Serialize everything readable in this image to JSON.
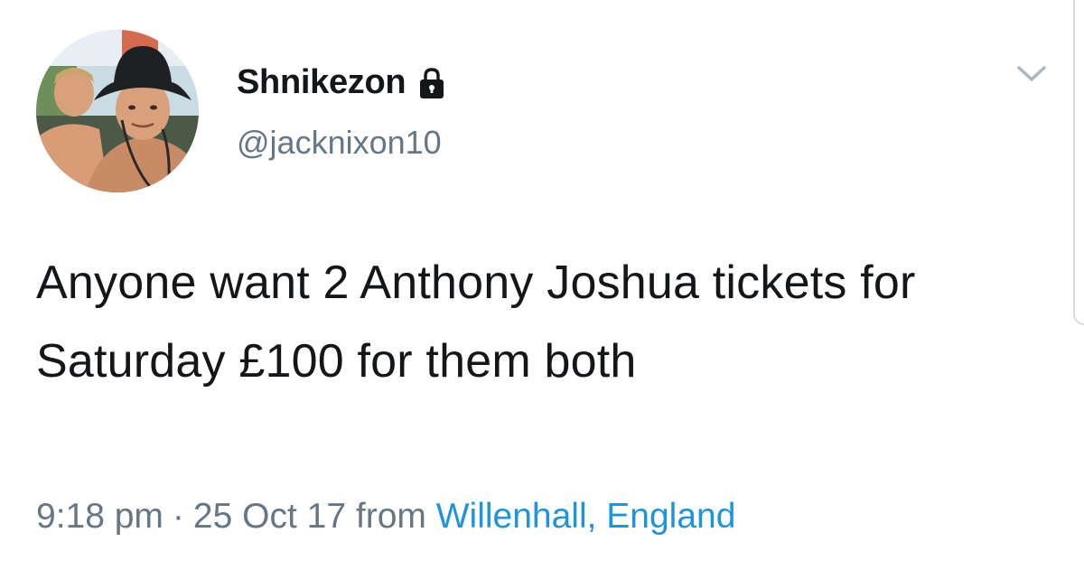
{
  "tweet": {
    "display_name": "Shnikezon",
    "handle": "@jacknixon10",
    "text": "Anyone want 2 Anthony Joshua tickets for Saturday £100 for them both",
    "time": "9:18 pm",
    "separator": "·",
    "date": "25 Oct 17",
    "from_label": "from",
    "location": "Willenhall, England"
  },
  "icons": {
    "protected": "lock-icon",
    "menu": "chevron-down-icon"
  },
  "colors": {
    "text": "#14171a",
    "secondary": "#657786",
    "link": "#1b95e0",
    "chevron": "#aab8c2"
  }
}
